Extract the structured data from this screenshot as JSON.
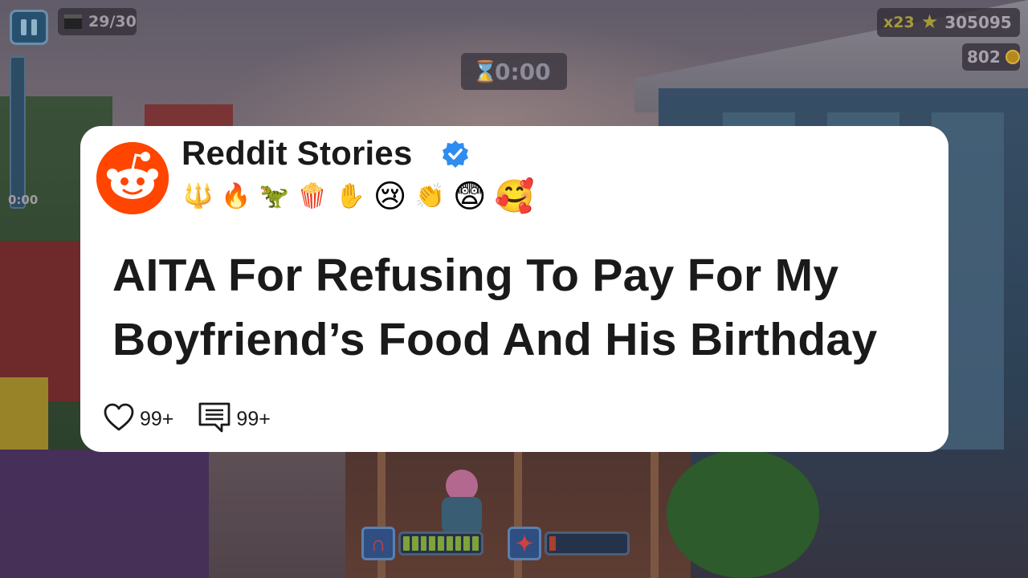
{
  "hud": {
    "clips": "29/30",
    "timer": "0:00",
    "side_timer": "0:00",
    "multiplier": "x23",
    "score": "305095",
    "coins": "802",
    "powerups": [
      {
        "name": "magnet",
        "fill": 0.95
      },
      {
        "name": "jetpack",
        "fill": 0.1
      }
    ]
  },
  "card": {
    "channel_name": "Reddit Stories",
    "emojis": [
      "🔱",
      "🔥",
      "🦖",
      "🍿",
      "✋",
      "😢",
      "👏",
      "😨",
      "🥰"
    ],
    "title": "AITA For Refusing To Pay For My Boyfriend’s Food And His Birthday",
    "likes": "99+",
    "comments": "99+"
  },
  "colors": {
    "reddit_orange": "#ff4500",
    "verified_blue": "#2f8cf0",
    "card_bg": "#ffffff",
    "text": "#1a1a1b"
  },
  "icons": {
    "avatar": "reddit-snoo-icon",
    "verified": "verified-badge-icon",
    "like": "heart-icon",
    "comment": "comment-icon",
    "pause": "pause-icon",
    "clips": "clapperboard-icon",
    "timer": "hourglass-icon",
    "multiplier": "star-icon",
    "coins": "coin-icon"
  }
}
